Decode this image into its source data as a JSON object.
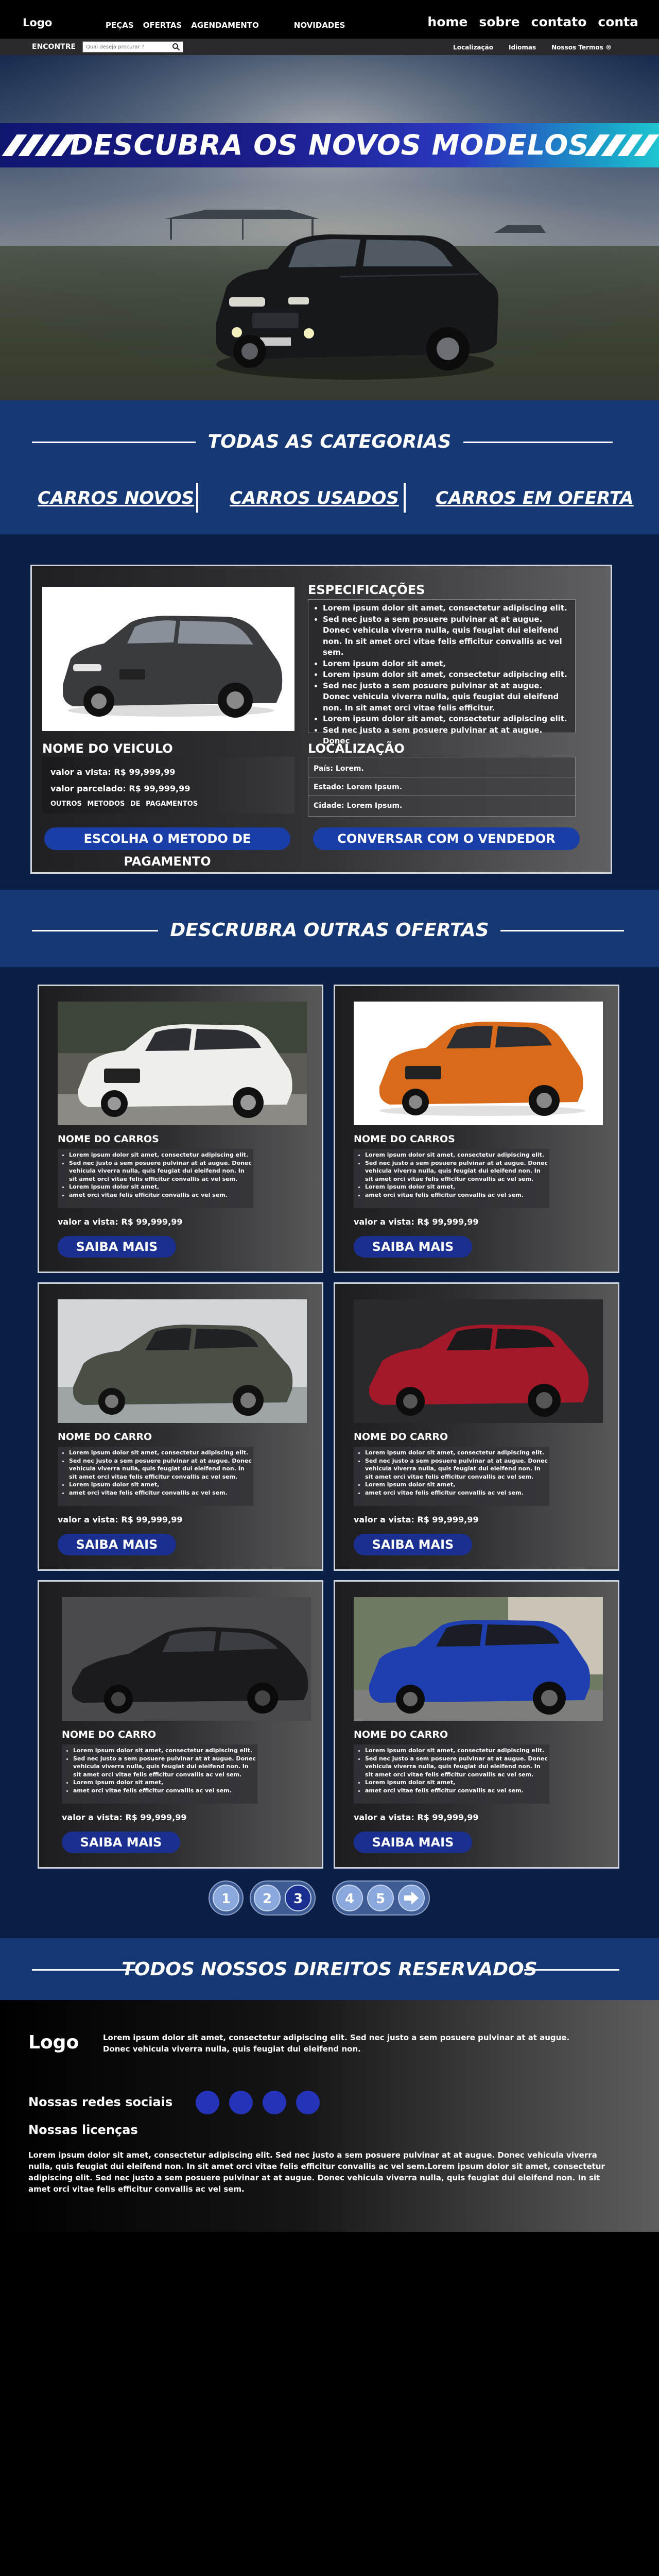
{
  "header": {
    "logo": "Logo",
    "nav_left": [
      "PEÇAS",
      "OFERTAS",
      "AGENDAMENTO",
      "NOVIDADES"
    ],
    "nav_right": [
      "home",
      "sobre",
      "contato",
      "conta"
    ]
  },
  "subbar": {
    "encontre": "ENCONTRE",
    "search_placeholder": "Qual deseja procurar ?",
    "links": [
      "Localização",
      "Idiomas",
      "Nossos Termos ®"
    ]
  },
  "hero": {
    "title": "DESCUBRA OS NOVOS MODELOS"
  },
  "categories": {
    "title": "TODAS AS CATEGORIAS",
    "links": [
      "CARROS NOVOS",
      "CARROS USADOS",
      "CARROS EM OFERTA"
    ]
  },
  "featured": {
    "name": "NOME DO VEICULO",
    "price_cash": "valor a vista:  R$ 99,999,99",
    "price_parcel": "valor  parcelado:  R$ 99,999,99",
    "payment_methods": "OUTROS  METODOS  DE  PAGAMENTOS",
    "btn_payment": "ESCOLHA O METODO DE PAGAMENTO",
    "spec_title": "ESPECIFICAÇÕES",
    "specs": [
      "Lorem ipsum dolor sit amet, consectetur adipiscing elit.",
      "Sed nec justo a sem posuere pulvinar at at augue. Donec vehicula viverra nulla, quis feugiat dui eleifend non. In sit amet orci vitae felis efficitur convallis ac vel sem.",
      "Lorem ipsum dolor sit amet,",
      "Lorem ipsum dolor sit amet, consectetur adipiscing elit.",
      "Sed nec justo a sem posuere pulvinar at at augue. Donec vehicula viverra nulla, quis feugiat dui eleifend non. In sit amet orci vitae felis efficitur.",
      "Lorem ipsum dolor sit amet, consectetur adipiscing elit.",
      "Sed nec justo a sem posuere pulvinar at at augue. Donec"
    ],
    "loc_title": "LOCALIZAÇÃO",
    "loc_pais": "País: Lorem.",
    "loc_estado": "Estado: Lorem Ipsum.",
    "loc_cidade": "Cidade: Lorem Ipsum.",
    "btn_seller": "CONVERSAR COM O VENDEDOR"
  },
  "offers_title": "DESCRUBRA OUTRAS  OFERTAS",
  "offers": [
    {
      "name": "NOME DO CARROS",
      "price": "valor a vista:  R$ 99,999,99",
      "btn": "SAIBA MAIS"
    },
    {
      "name": "NOME DO CARROS",
      "price": "valor a vista:  R$ 99,999,99",
      "btn": "SAIBA MAIS"
    },
    {
      "name": "NOME DO CARRO",
      "price": "valor a vista:  R$ 99,999,99",
      "btn": "SAIBA MAIS"
    },
    {
      "name": "NOME DO CARRO",
      "price": "valor a vista:  R$ 99,999,99",
      "btn": "SAIBA MAIS"
    },
    {
      "name": "NOME DO CARRO",
      "price": "valor a vista:  R$ 99,999,99",
      "btn": "SAIBA MAIS"
    },
    {
      "name": "NOME DO CARRO",
      "price": "valor a vista:  R$ 99,999,99",
      "btn": "SAIBA MAIS"
    }
  ],
  "offer_bullets": [
    "Lorem ipsum dolor sit amet, consectetur adipiscing elit.",
    "Sed nec justo a sem posuere pulvinar at at augue. Donec vehicula viverra nulla, quis feugiat dui eleifend non. In sit amet orci vitae felis efficitur convallis ac vel sem.",
    "Lorem ipsum dolor sit amet,",
    "amet orci vitae felis efficitur convallis ac vel sem."
  ],
  "pagination": [
    "1",
    "2",
    "3",
    "4",
    "5"
  ],
  "pagination_active": "3",
  "rights": "TODOS NOSSOS DIREITOS RESERVADOS",
  "footer": {
    "logo": "Logo",
    "text": "Lorem ipsum dolor sit amet, consectetur adipiscing elit. Sed nec justo a sem posuere pulvinar at at augue. Donec vehicula viverra nulla, quis feugiat dui eleifend non.",
    "social_title": "Nossas redes sociais",
    "license_title": "Nossas licenças",
    "license_text": "Lorem ipsum dolor sit amet, consectetur adipiscing elit. Sed nec justo a sem posuere pulvinar at at augue. Donec vehicula viverra nulla, quis feugiat dui eleifend non. In sit amet orci vitae felis efficitur convallis ac vel sem.Lorem ipsum dolor sit amet, consectetur adipiscing elit. Sed nec justo a sem posuere pulvinar at at augue. Donec vehicula viverra nulla, quis feugiat dui eleifend non. In sit amet orci vitae felis efficitur convallis ac vel sem."
  },
  "colors": {
    "brand_blue": "#163874",
    "deep_navy": "#0a1f45",
    "button_blue": "#1a3ea8"
  }
}
